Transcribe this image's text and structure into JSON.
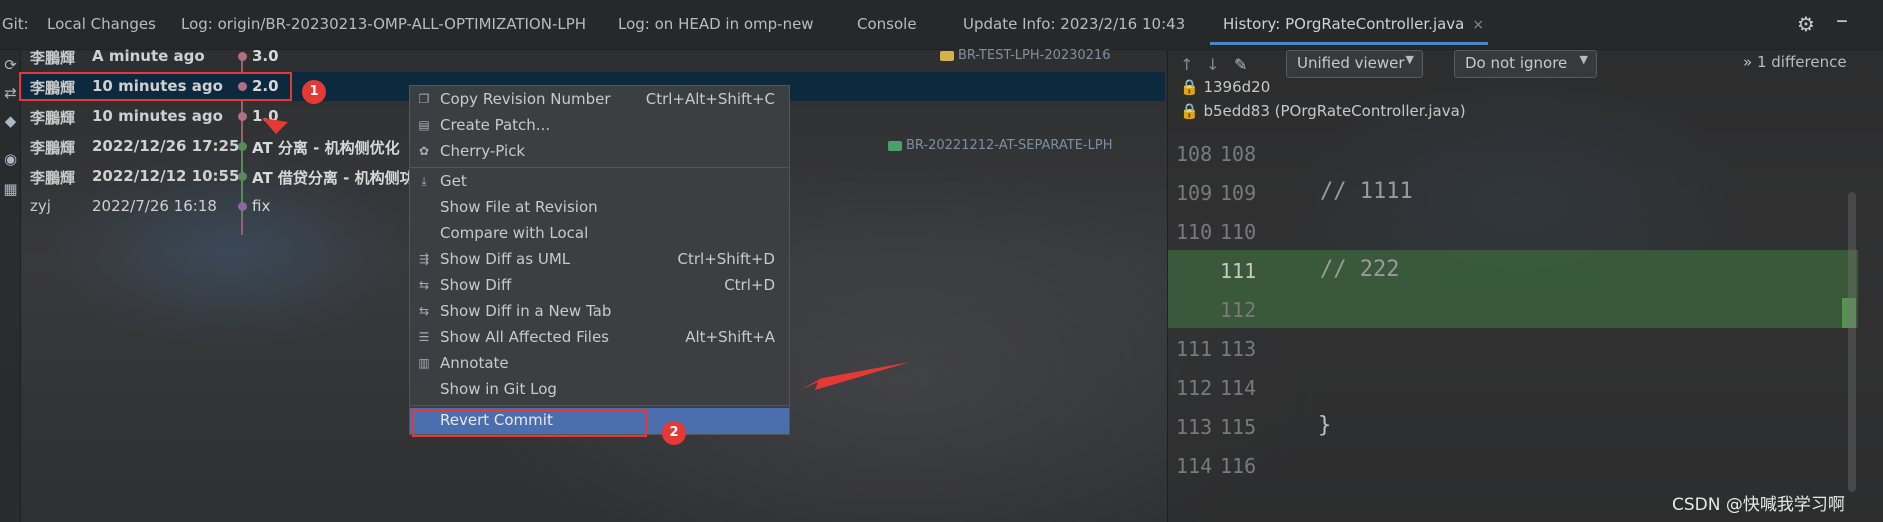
{
  "top_bar": {
    "git_label": "Git:",
    "tabs": [
      {
        "label": "Local Changes"
      },
      {
        "label": "Log: origin/BR-20230213-OMP-ALL-OPTIMIZATION-LPH"
      },
      {
        "label": "Log: on HEAD in omp-new"
      },
      {
        "label": "Console"
      },
      {
        "label": "Update Info: 2023/2/16 10:43"
      },
      {
        "label": "History: POrgRateController.java"
      }
    ],
    "close_glyph": "×",
    "icons": [
      "gear-icon",
      "minimize-icon"
    ]
  },
  "left_toolbar_icons": [
    "refresh-icon",
    "branch-icon",
    "commit-icon",
    "eye-icon",
    "layout-icon"
  ],
  "log": {
    "rows": [
      {
        "author": "李鵬輝",
        "date": "A minute ago",
        "message": "3.0",
        "bold": true
      },
      {
        "author": "李鵬輝",
        "date": "10 minutes ago",
        "message": "2.0",
        "bold": true,
        "selected": true
      },
      {
        "author": "李鵬輝",
        "date": "10 minutes ago",
        "message": "1.0",
        "bold": true
      },
      {
        "author": "李鵬輝",
        "date": "2022/12/26 17:25",
        "message": "AT 分离 - 机构侧优化",
        "bold": true
      },
      {
        "author": "李鵬輝",
        "date": "2022/12/12 10:55",
        "message": "AT 借贷分离 - 机构侧功",
        "bold": true
      },
      {
        "author": "zyj",
        "date": "2022/7/26 16:18",
        "message": "fix",
        "bold": false
      }
    ],
    "tags": [
      {
        "label": "BR-TEST-LPH-20230216",
        "color": "#d6b24a"
      },
      {
        "label": "BR-20221212-AT-SEPARATE-LPH",
        "color": "#4aa06a"
      }
    ]
  },
  "annotations": {
    "badge1": "1",
    "badge2": "2"
  },
  "context_menu": {
    "items": [
      {
        "label": "Copy Revision Number",
        "shortcut": "Ctrl+Alt+Shift+C",
        "icon": "copy-icon"
      },
      {
        "label": "Create Patch...",
        "shortcut": "",
        "icon": "patch-icon"
      },
      {
        "label": "Cherry-Pick",
        "shortcut": "",
        "icon": "cherry-icon"
      },
      {
        "label": "Get",
        "shortcut": "",
        "icon": "download-icon"
      },
      {
        "label": "Show File at Revision",
        "shortcut": "",
        "icon": ""
      },
      {
        "label": "Compare with Local",
        "shortcut": "",
        "icon": ""
      },
      {
        "label": "Show Diff as UML",
        "shortcut": "Ctrl+Shift+D",
        "icon": "diff-uml-icon"
      },
      {
        "label": "Show Diff",
        "shortcut": "Ctrl+D",
        "icon": "diff-icon"
      },
      {
        "label": "Show Diff in a New Tab",
        "shortcut": "",
        "icon": "diff-icon"
      },
      {
        "label": "Show All Affected Files",
        "shortcut": "Alt+Shift+A",
        "icon": "files-icon"
      },
      {
        "label": "Annotate",
        "shortcut": "",
        "icon": "annotate-icon"
      },
      {
        "label": "Show in Git Log",
        "shortcut": "",
        "icon": ""
      },
      {
        "label": "Revert Commit",
        "shortcut": "",
        "icon": "",
        "highlighted": true
      }
    ]
  },
  "diff_panel": {
    "viewer_combo": "Unified viewer",
    "ignore_combo": "Do not ignore",
    "difference_count": "1 difference",
    "chevrons": "»",
    "revision_hash": "1396d20",
    "revision_file": "b5edd83 (POrgRateController.java)",
    "lines": [
      {
        "left": "108",
        "right": "108",
        "code": ""
      },
      {
        "left": "109",
        "right": "109",
        "code": "// 1111"
      },
      {
        "left": "110",
        "right": "110",
        "code": ""
      },
      {
        "left": "",
        "right": "111",
        "code": "// 222"
      },
      {
        "left": "",
        "right": "112",
        "code": ""
      },
      {
        "left": "111",
        "right": "113",
        "code": ""
      },
      {
        "left": "112",
        "right": "114",
        "code": ""
      },
      {
        "left": "113",
        "right": "115",
        "code": "}"
      },
      {
        "left": "114",
        "right": "116",
        "code": ""
      }
    ]
  },
  "watermark": "CSDN @快喊我学习啊"
}
